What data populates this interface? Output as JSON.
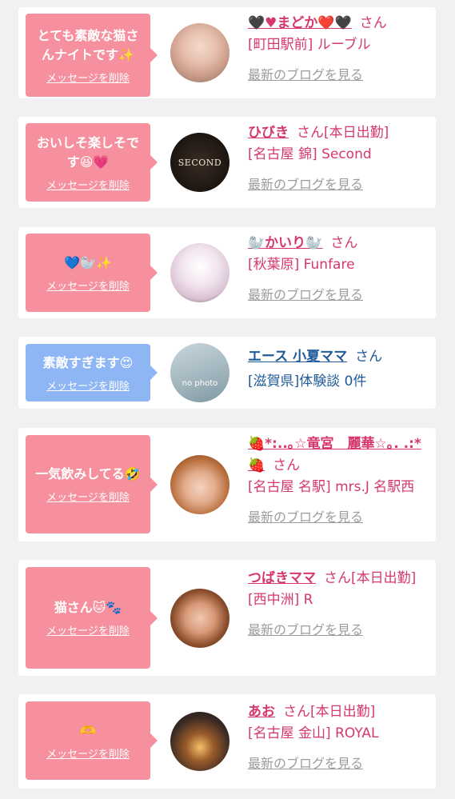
{
  "cards": [
    {
      "message": "とても素敵な猫さんナイトです✨",
      "delete_label": "メッセージを削除",
      "name": "🖤♥まどか❤️🖤",
      "san": "さん",
      "place": "[町田駅前] ルーブル",
      "blog_link": "最新のブログを見る"
    },
    {
      "message": "おいしそ楽しそです😆💗",
      "delete_label": "メッセージを削除",
      "name": "ひびき",
      "san": "さん[本日出勤]",
      "place": "[名古屋 錦] Second",
      "blog_link": "最新のブログを見る",
      "avatar_text": "SECOND"
    },
    {
      "message": "💙🦭✨",
      "delete_label": "メッセージを削除",
      "name": "🦭かいり🦭",
      "san": "さん",
      "place": "[秋葉原] Funfare",
      "blog_link": "最新のブログを見る"
    },
    {
      "message": "素敵すぎます😍",
      "delete_label": "メッセージを削除",
      "name": "エース 小夏ママ",
      "san": "さん",
      "place": "[滋賀県]体験談 0件",
      "avatar_text": "no photo"
    },
    {
      "message": "一気飲みしてる🤣",
      "delete_label": "メッセージを削除",
      "name": "🍓*:..｡☆竜宮　麗華☆｡. .:*🍓",
      "san": "さん",
      "place": "[名古屋 名駅] mrs.J 名駅西",
      "blog_link": "最新のブログを見る"
    },
    {
      "message": "猫さん🐱🐾",
      "delete_label": "メッセージを削除",
      "name": "つばきママ",
      "san": "さん[本日出勤]",
      "place": "[西中洲] R",
      "blog_link": "最新のブログを見る"
    },
    {
      "message": "🫶",
      "delete_label": "メッセージを削除",
      "name": "あお",
      "san": "さん[本日出勤]",
      "place": "[名古屋 金山] ROYAL",
      "blog_link": "最新のブログを見る"
    }
  ]
}
